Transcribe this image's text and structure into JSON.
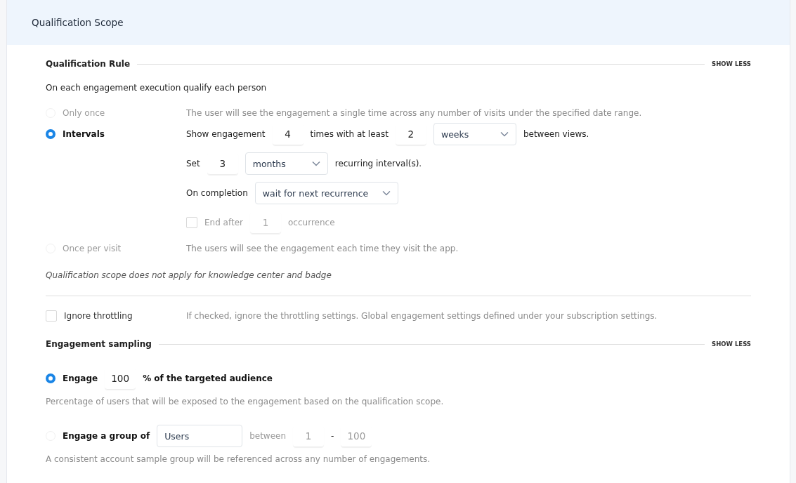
{
  "panel": {
    "title": "Qualification Scope"
  },
  "qualification_rule": {
    "heading": "Qualification Rule",
    "toggle": "SHOW LESS",
    "intro": "On each engagement execution qualify each person",
    "options": [
      {
        "label": "Only once",
        "selected": false,
        "description": "The user will see the engagement a single time across any number of visits under the specified date range."
      },
      {
        "label": "Intervals",
        "selected": true,
        "lines": [
          {
            "disabled": false,
            "parts": [
              {
                "kind": "text",
                "text": "Show engagement"
              },
              {
                "kind": "number",
                "value": "4"
              },
              {
                "kind": "text",
                "text": "times with at least"
              },
              {
                "kind": "number",
                "value": "2"
              },
              {
                "kind": "select",
                "value": "weeks"
              },
              {
                "kind": "text",
                "text": "between views."
              }
            ]
          },
          {
            "disabled": false,
            "parts": [
              {
                "kind": "text",
                "text": "Set"
              },
              {
                "kind": "number",
                "value": "3"
              },
              {
                "kind": "select",
                "value": "months"
              },
              {
                "kind": "text",
                "text": "recurring interval(s)."
              }
            ]
          },
          {
            "disabled": false,
            "parts": [
              {
                "kind": "text",
                "text": "On completion"
              },
              {
                "kind": "select",
                "value": "wait for next recurrence"
              }
            ]
          },
          {
            "disabled": true,
            "parts": [
              {
                "kind": "checkbox",
                "checked": false,
                "text": "End after"
              },
              {
                "kind": "number",
                "value": "1"
              },
              {
                "kind": "text",
                "text": "occurrence"
              }
            ]
          }
        ]
      },
      {
        "label": "Once per visit",
        "selected": false,
        "description": "The users will see the engagement each time they visit the app."
      }
    ],
    "note": "Qualification scope does not apply for knowledge center and badge"
  },
  "ignore_throttling": {
    "label": "Ignore throttling",
    "checked": false,
    "description": "If checked, ignore the throttling settings. Global engagement settings defined under your subscription settings."
  },
  "engagement_sampling": {
    "heading": "Engagement sampling",
    "toggle": "SHOW LESS",
    "options": [
      {
        "selected": true,
        "parts": [
          {
            "kind": "label",
            "text": "Engage"
          },
          {
            "kind": "number",
            "value": "100"
          },
          {
            "kind": "label",
            "text": "% of the targeted audience"
          }
        ],
        "description": "Percentage of users that will be exposed to the engagement based on the qualification scope."
      },
      {
        "selected": false,
        "parts": [
          {
            "kind": "label",
            "text": "Engage a group of"
          },
          {
            "kind": "field",
            "value": "Users"
          },
          {
            "kind": "text",
            "text": "between"
          },
          {
            "kind": "number",
            "value": "1"
          },
          {
            "kind": "sep",
            "text": "-"
          },
          {
            "kind": "number",
            "value": "100"
          }
        ],
        "description": "A consistent account sample group will be referenced across any number of engagements."
      }
    ]
  }
}
